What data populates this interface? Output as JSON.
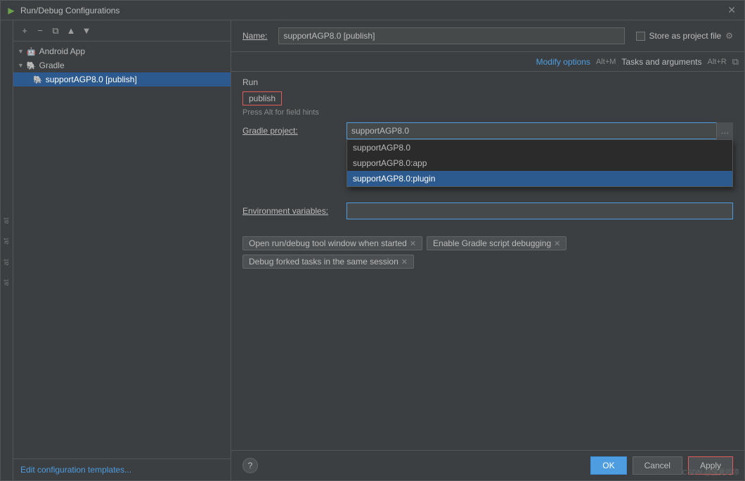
{
  "titleBar": {
    "icon": "▶",
    "title": "Run/Debug Configurations",
    "close": "✕"
  },
  "toolbar": {
    "add": "+",
    "remove": "−",
    "copy": "⧉",
    "moveUp": "▲",
    "moveDown": "▼"
  },
  "tree": {
    "androidApp": {
      "label": "Android App",
      "expanded": true
    },
    "gradle": {
      "label": "Gradle",
      "expanded": true,
      "children": [
        {
          "label": "supportAGP8.0 [publish]",
          "selected": true
        }
      ]
    }
  },
  "footer": {
    "editTemplatesLink": "Edit configuration templates..."
  },
  "header": {
    "nameLabel": "Name:",
    "nameValue": "supportAGP8.0 [publish]",
    "storeLabel": "Store as project file",
    "gearIcon": "⚙"
  },
  "optionsBar": {
    "modifyOptions": "Modify options",
    "arrow": "∨",
    "shortcut": "Alt+M",
    "tasksAndArgs": "Tasks and arguments",
    "tasksShortcut": "Alt+R",
    "copyIcon": "⧉"
  },
  "runSection": {
    "header": "Run",
    "taskTag": "publish",
    "hintText": "Press Alt for field hints"
  },
  "form": {
    "gradleProjectLabel": "Gradle project:",
    "gradleProjectValue": "supportAGP8.0",
    "envVarsLabel": "Environment variables:",
    "dropdownItems": [
      {
        "label": "supportAGP8.0",
        "selected": false
      },
      {
        "label": "supportAGP8.0:app",
        "selected": false
      },
      {
        "label": "supportAGP8.0:plugin",
        "selected": true
      }
    ]
  },
  "chips": [
    {
      "label": "Open run/debug tool window when started",
      "closable": true
    },
    {
      "label": "Enable Gradle script debugging",
      "closable": true
    },
    {
      "label": "Debug forked tasks in the same session",
      "closable": true
    }
  ],
  "bottomBar": {
    "help": "?",
    "ok": "OK",
    "cancel": "Cancel",
    "apply": "Apply"
  },
  "sideLabels": [
    "at",
    "at",
    "at",
    "at"
  ],
  "watermark": "CSDN @盛夏的凉"
}
